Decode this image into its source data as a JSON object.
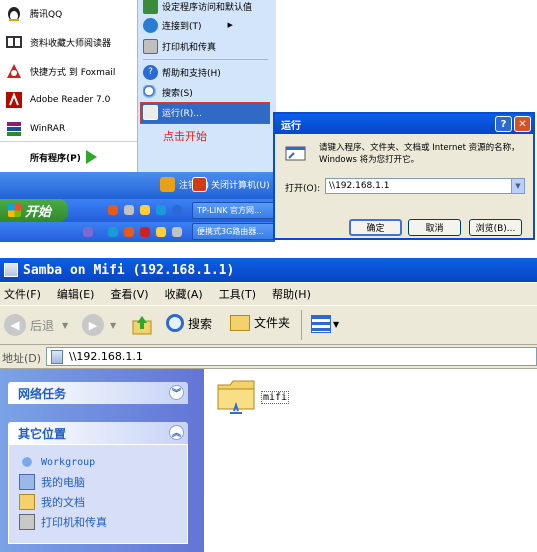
{
  "start_menu": {
    "left_items": [
      {
        "label": "腾讯QQ",
        "icon": "qq-penguin-icon"
      },
      {
        "label": "资料收藏大师阅读器",
        "icon": "book-reader-icon"
      },
      {
        "label": "快捷方式 到 Foxmail",
        "icon": "foxmail-icon"
      },
      {
        "label": "Adobe Reader 7.0",
        "icon": "adobe-reader-icon"
      },
      {
        "label": "WinRAR",
        "icon": "winrar-icon"
      }
    ],
    "all_programs": "所有程序(P)",
    "right_items": [
      {
        "label": "设定程序访问和默认值",
        "icon": "program-access-icon"
      },
      {
        "label": "连接到(T)",
        "icon": "connect-globe-icon"
      },
      {
        "label": "打印机和传真",
        "icon": "printer-icon"
      },
      {
        "label": "帮助和支持(H)",
        "icon": "help-icon"
      },
      {
        "label": "搜索(S)",
        "icon": "search-icon"
      },
      {
        "label": "运行(R)...",
        "icon": "run-icon"
      }
    ],
    "annotation": "点击开始",
    "logoff": "注销(L)",
    "shutdown": "关闭计算机(U)"
  },
  "taskbar": {
    "start_label": "开始",
    "window_buttons": [
      "TP-LINK 官方网...",
      "便携式3G路由器..."
    ]
  },
  "run_dialog": {
    "title": "运行",
    "help_btn": "?",
    "close_btn": "✕",
    "description": "请键入程序、文件夹、文档或 Internet 资源的名称，Windows 将为您打开它。",
    "open_label": "打开(O):",
    "open_value": "\\\\192.168.1.1",
    "ok": "确定",
    "cancel": "取消",
    "browse": "浏览(B)..."
  },
  "explorer": {
    "title": "Samba on Mifi (192.168.1.1)",
    "menu": [
      "文件(F)",
      "编辑(E)",
      "查看(V)",
      "收藏(A)",
      "工具(T)",
      "帮助(H)"
    ],
    "toolbar": {
      "back": "后退",
      "search": "搜索",
      "folders": "文件夹"
    },
    "address_label": "地址(D)",
    "address_value": "\\\\192.168.1.1",
    "network_tasks": "网络任务",
    "other_places": "其它位置",
    "other_links": [
      "Workgroup",
      "我的电脑",
      "我的文档",
      "打印机和传真"
    ],
    "folder_item": "mifi"
  },
  "colors": {
    "xp_blue": "#0a4fd2",
    "start_green": "#2f8a2a",
    "link_blue": "#215dc6",
    "pane_blue": "#6375d6"
  }
}
